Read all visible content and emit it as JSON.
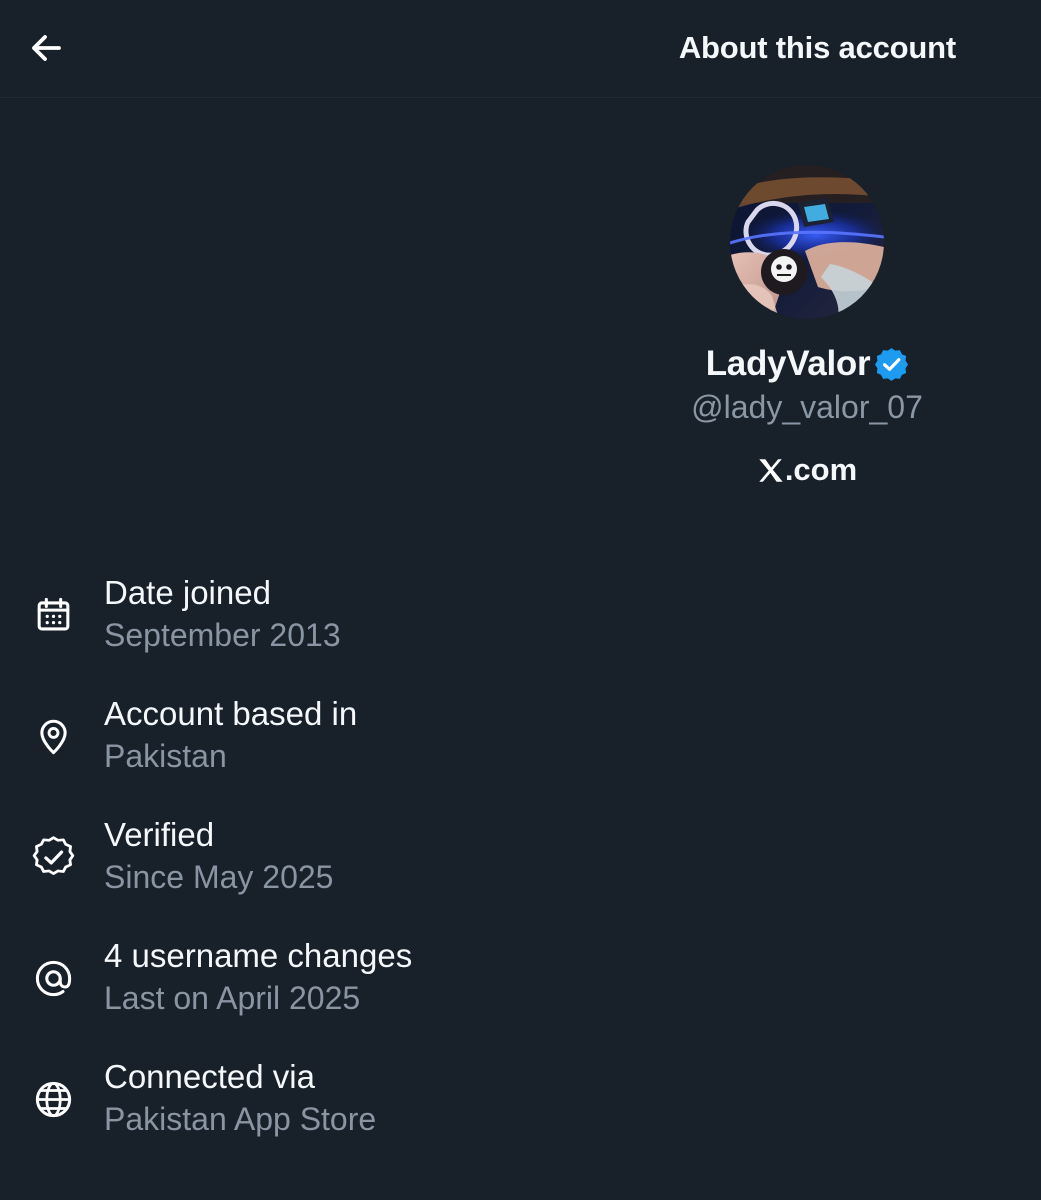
{
  "colors": {
    "background": "#18202a",
    "primary_text": "#f5f8fa",
    "secondary_text": "#8995a3",
    "verified_blue": "#1d9bf0"
  },
  "header": {
    "back_icon": "arrow-left-icon",
    "title": "About this account"
  },
  "profile": {
    "display_name": "LadyValor",
    "verified_icon": "verified-badge-icon",
    "handle": "@lady_valor_07",
    "site_icon": "x-logo-icon",
    "site_suffix": ".com"
  },
  "details": [
    {
      "icon": "calendar-icon",
      "title": "Date joined",
      "value": "September 2013"
    },
    {
      "icon": "location-pin-icon",
      "title": "Account based in",
      "value": "Pakistan"
    },
    {
      "icon": "verified-check-icon",
      "title": "Verified",
      "value": "Since May 2025"
    },
    {
      "icon": "at-sign-icon",
      "title": "4 username changes",
      "value": "Last on April 2025"
    },
    {
      "icon": "globe-icon",
      "title": "Connected via",
      "value": "Pakistan App Store"
    }
  ]
}
